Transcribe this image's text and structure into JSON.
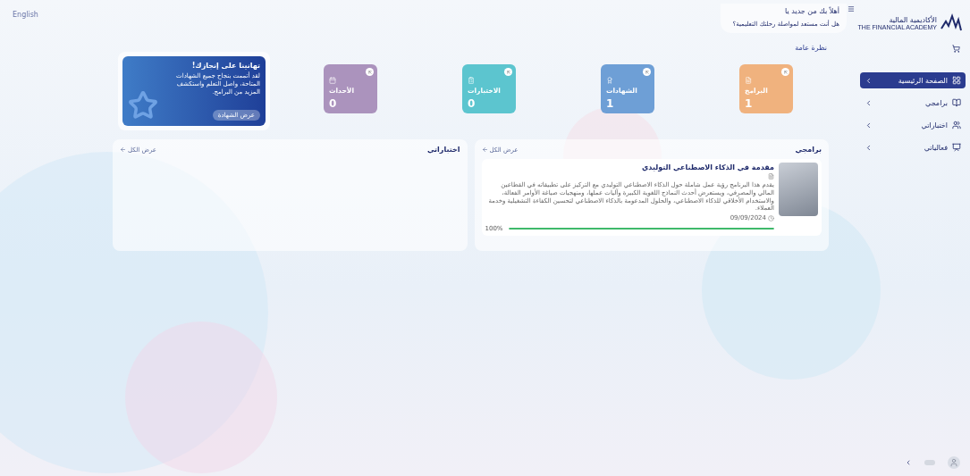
{
  "language_link": "English",
  "greeting": {
    "title": "أهلاً بك من جديد يا",
    "subtitle": "هل أنت مستعد لمواصلة رحلتك التعليمية؟"
  },
  "logo": {
    "name": "الأكاديمية المالية",
    "tagline": "THE FINANCIAL ACADEMY"
  },
  "sidebar": {
    "items": [
      {
        "label": "الصفحة الرئيسية",
        "selected": true
      },
      {
        "label": "برامجي",
        "selected": false
      },
      {
        "label": "اختباراتي",
        "selected": false
      },
      {
        "label": "فعالياتي",
        "selected": false
      }
    ]
  },
  "overview": {
    "title": "نظرة عامة",
    "stats": [
      {
        "label": "البرامج",
        "value": "1",
        "color": "#f0b27e"
      },
      {
        "label": "الشهادات",
        "value": "1",
        "color": "#6e9fd6"
      },
      {
        "label": "الاختبارات",
        "value": "0",
        "color": "#5cc5cf"
      },
      {
        "label": "الأحداث",
        "value": "0",
        "color": "#ab93bd"
      }
    ]
  },
  "promo": {
    "title": "تهانينا على إنجازك!",
    "body": "لقد أتممت بنجاح جميع الشهادات المتاحة، واصل التعلم واستكشف المزيد من البرامج.",
    "button": "عرض الشهادة"
  },
  "programs_panel": {
    "title": "برامجي",
    "view_all": "عرض الكل",
    "programs": [
      {
        "title": "مقدمة في الذكاء الاصطناعي التوليدي",
        "description": "يقدم هذا البرنامج رؤية عمل شاملة حول الذكاء الاصطناعي التوليدي مع التركيز على تطبيقاته في القطاعين المالي والمصرفي، ويستعرض أحدث النماذج اللغوية الكبيرة وآليات عملها، ومنهجيات صياغة الأوامر الفعالة، والاستخدام الأخلاقي للذكاء الاصطناعي، والحلول المدعومة بالذكاء الاصطناعي لتحسين الكفاءة التشغيلية وخدمة العملاء.",
        "date": "09/09/2024",
        "progress": {
          "level": 1,
          "reading": "100%"
        }
      }
    ]
  },
  "tests_panel": {
    "title": "اختباراتي",
    "view_all": "عرض الكل"
  }
}
